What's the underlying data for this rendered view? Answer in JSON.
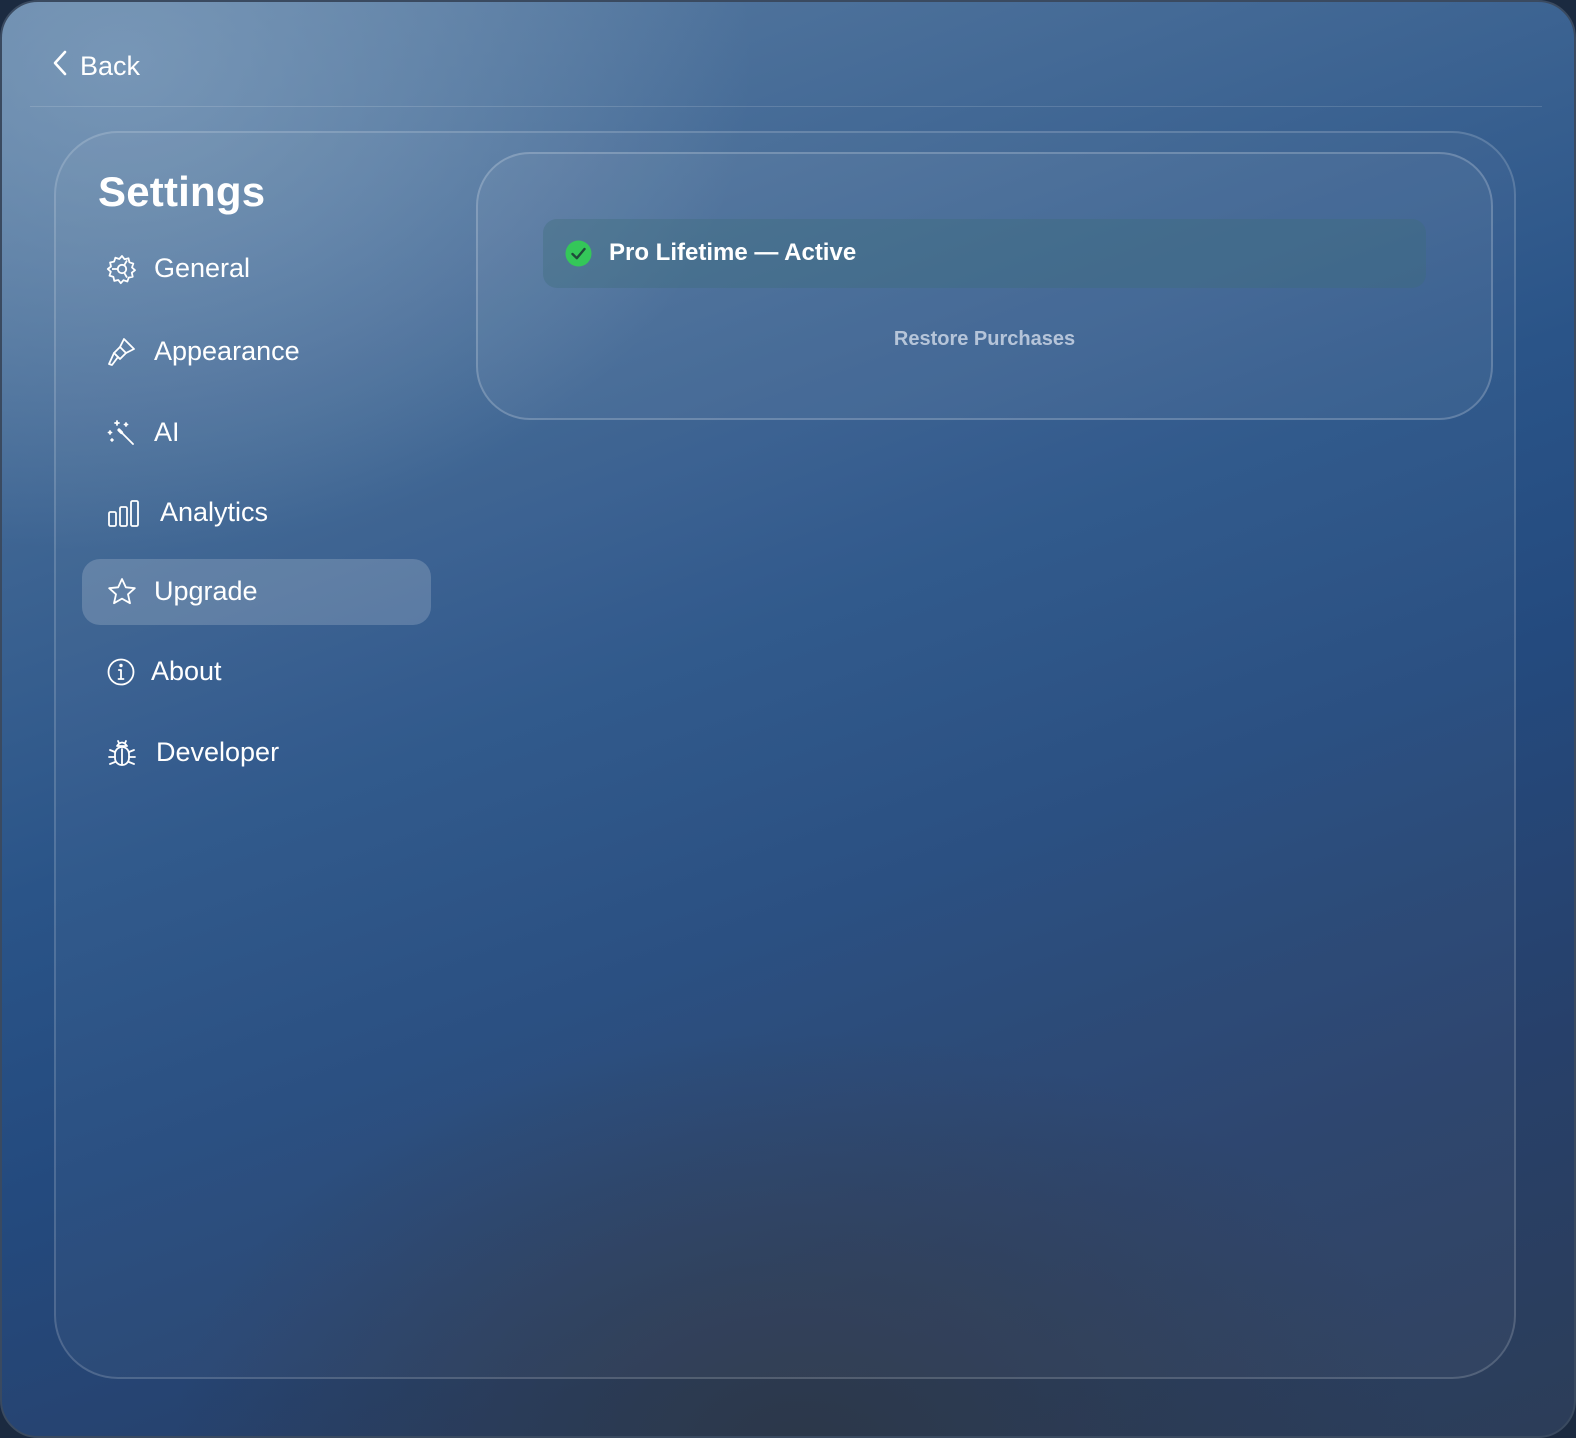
{
  "header": {
    "back_label": "Back"
  },
  "settings": {
    "title": "Settings"
  },
  "sidebar": {
    "items": [
      {
        "label": "General",
        "icon": "gear-icon"
      },
      {
        "label": "Appearance",
        "icon": "paintbrush-icon"
      },
      {
        "label": "AI",
        "icon": "magic-wand-icon"
      },
      {
        "label": "Analytics",
        "icon": "bar-chart-icon"
      },
      {
        "label": "Upgrade",
        "icon": "star-icon",
        "selected": true
      },
      {
        "label": "About",
        "icon": "info-icon"
      },
      {
        "label": "Developer",
        "icon": "bug-icon"
      }
    ]
  },
  "upgrade": {
    "status_text": "Pro Lifetime — Active",
    "status_icon": "checkmark-circle-icon",
    "restore_label": "Restore Purchases"
  },
  "colors": {
    "status_green": "#34c759",
    "selected_item_bg": "#5a7ba0"
  }
}
